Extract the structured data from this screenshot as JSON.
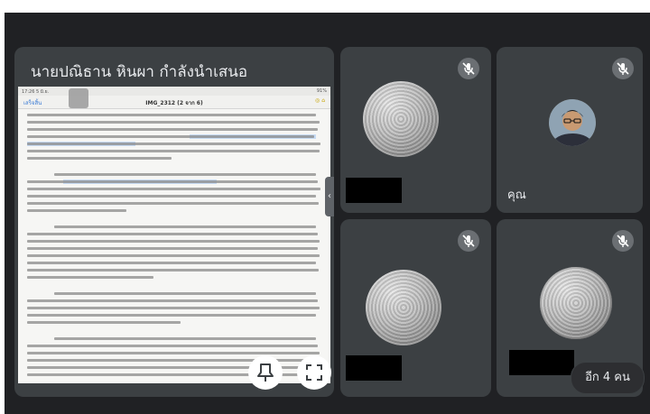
{
  "presentation": {
    "title": "นายปณิธาน หินผา กำลังนำเสนอ",
    "doc_title": "IMG_2312 (2 จาก 6)",
    "doc_back": "เสร็จสิ้น",
    "status_time": "17:26 5 มิ.ย.",
    "status_battery": "91%"
  },
  "participants": [
    {
      "id": "p1",
      "muted": true,
      "avatar": "blurred"
    },
    {
      "id": "self",
      "muted": true,
      "name": "คุณ",
      "avatar": "photo"
    },
    {
      "id": "p3",
      "muted": true,
      "avatar": "blurred"
    },
    {
      "id": "p4",
      "muted": true,
      "avatar": "blurred"
    }
  ],
  "more_participants": "อีก 4 คน",
  "icons": {
    "pin": "pin-icon",
    "fullscreen": "fullscreen-icon",
    "mic_off": "mic-off-icon",
    "side_handle": "chevron-left-icon"
  }
}
